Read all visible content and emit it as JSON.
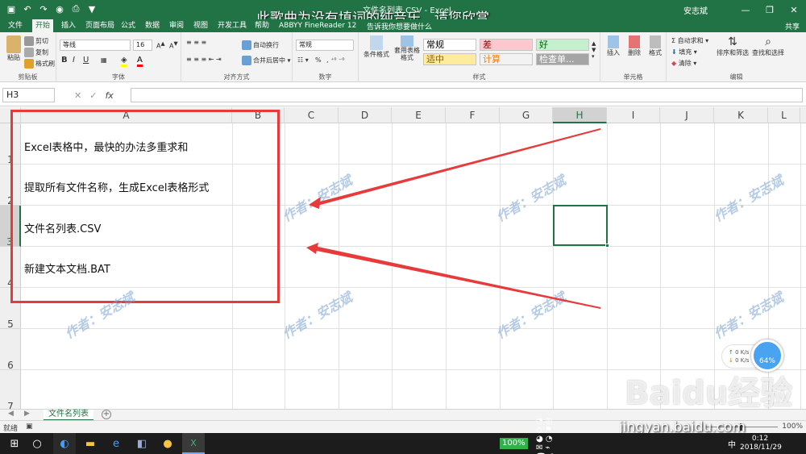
{
  "title_bar": {
    "document_title": "文件名列表.CSV - Excel",
    "subtitle_overlay": "此歌曲为没有填词的纯音乐，请您欣赏",
    "user_name": "安志斌",
    "window_buttons": [
      "—",
      "❐",
      "✕"
    ]
  },
  "tabs": [
    {
      "label": "文件"
    },
    {
      "label": "开始"
    },
    {
      "label": "插入"
    },
    {
      "label": "页面布局"
    },
    {
      "label": "公式"
    },
    {
      "label": "数据"
    },
    {
      "label": "审阅"
    },
    {
      "label": "视图"
    },
    {
      "label": "开发工具"
    },
    {
      "label": "帮助"
    },
    {
      "label": "ABBYY FineReader 12"
    }
  ],
  "tell_me": "告诉我你想要做什么",
  "share": "共享",
  "ribbon": {
    "clipboard": {
      "label": "剪贴板",
      "paste": "粘贴",
      "cut": "剪切",
      "copy": "复制",
      "format_painter": "格式刷"
    },
    "font": {
      "label": "字体",
      "font_name": "等线",
      "font_size": "16",
      "bold": "B",
      "italic": "I",
      "underline": "U"
    },
    "alignment": {
      "label": "对齐方式",
      "wrap_text": "自动换行",
      "merge_center": "合并后居中"
    },
    "number": {
      "label": "数字",
      "format": "常规",
      "percent": "%"
    },
    "styles": {
      "label": "样式",
      "conditional_format": "条件格式",
      "format_as_table": "套用表格格式",
      "cells": [
        {
          "text": "常规",
          "bg": "#ffffff",
          "color": "#000000"
        },
        {
          "text": "差",
          "bg": "#ffc7ce",
          "color": "#9c0006"
        },
        {
          "text": "好",
          "bg": "#c6efce",
          "color": "#006100"
        },
        {
          "text": "适中",
          "bg": "#ffeb9c",
          "color": "#9c5700"
        },
        {
          "text": "计算",
          "bg": "#f2f2f2",
          "color": "#fa7d00"
        },
        {
          "text": "检查单...",
          "bg": "#a5a5a5",
          "color": "#ffffff"
        }
      ]
    },
    "cells_group": {
      "label": "单元格",
      "insert": "插入",
      "delete": "删除",
      "format": "格式"
    },
    "editing": {
      "label": "编辑",
      "autosum": "自动求和",
      "fill": "填充",
      "clear": "清除",
      "sort_filter": "排序和筛选",
      "find_select": "查找和选择"
    }
  },
  "formula_bar": {
    "name_box": "H3",
    "fx": "fx",
    "value": ""
  },
  "columns": [
    "A",
    "B",
    "C",
    "D",
    "E",
    "F",
    "G",
    "H",
    "I",
    "J",
    "K",
    "L"
  ],
  "selected_column": "H",
  "rows": [
    "1",
    "2",
    "3",
    "4",
    "5",
    "6",
    "7"
  ],
  "selected_row": "3",
  "cells": {
    "a1": "Excel表格中，最快的办法多重求和",
    "a2": "提取所有文件名称，生成Excel表格形式",
    "a3": "文件名列表.CSV",
    "a4": "新建文本文档.BAT"
  },
  "watermark_text": "作者：安志斌",
  "speed_widget": {
    "up": "0 K/s",
    "down": "0 K/s",
    "percent": "64%"
  },
  "sheet_tab": "文件名列表",
  "status": {
    "ready": "就绪",
    "zoom": "100%"
  },
  "taskbar": {
    "battery": "100%",
    "time": "0:12",
    "date": "2018/11/29",
    "ime": "中"
  },
  "brand_watermark": {
    "logo": "Baidu经验",
    "url": "jingyan.baidu.com"
  },
  "colors": {
    "excel_green": "#217346",
    "annotation_red": "#e8393b"
  }
}
